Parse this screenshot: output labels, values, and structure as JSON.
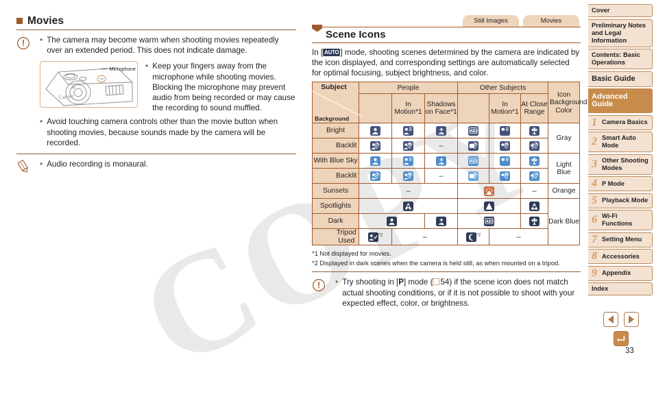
{
  "left": {
    "heading": "Movies",
    "caution_bullets": [
      "The camera may become warm when shooting movies repeatedly over an extended period. This does not indicate damage.",
      "Keep your fingers away from the microphone while shooting movies. Blocking the microphone may prevent audio from being recorded or may cause the recording to sound muffled.",
      "Avoid touching camera controls other than the movie button when shooting movies, because sounds made by the camera will be recorded."
    ],
    "figure_label": "Microphone",
    "memo_bullet": "Audio recording is monaural."
  },
  "section": {
    "tabs": [
      "Still Images",
      "Movies"
    ],
    "title": "Scene Icons",
    "intro_pre": "In [",
    "intro_chip": "AUTO",
    "intro_post": "] mode, shooting scenes determined by the camera are indicated by the icon displayed, and corresponding settings are automatically selected for optimal focusing, subject brightness, and color.",
    "footnotes": [
      "*1 Not displayed for movies.",
      "*2 Displayed in dark scenes when the camera is held still, as when mounted on a tripod."
    ],
    "caution_pre": "Try shooting in [",
    "caution_mode": "P",
    "caution_page": "54",
    "caution_post": ") if the scene icon does not match actual shooting conditions, or if it is not possible to shoot with your expected effect, color, or brightness.",
    "caution_mid": "] mode ("
  },
  "table": {
    "corner_subject": "Subject",
    "corner_background": "Background",
    "group_people": "People",
    "group_other": "Other Subjects",
    "col_icon_bg_color": "Icon Background Color",
    "sub_headers": {
      "people_in_motion": "In Motion*1",
      "people_shadows": "Shadows on Face*1",
      "other_in_motion": "In Motion*1",
      "other_close": "At Close Range"
    },
    "rows": [
      {
        "label": "Bright",
        "indent": false,
        "bgcolor": "Gray",
        "bgcolor_rowspan": 2,
        "cells": [
          {
            "kind": "icon",
            "icon": "person-icon",
            "color": "#45537a"
          },
          {
            "kind": "icon",
            "icon": "person-motion-icon",
            "color": "#45537a"
          },
          {
            "kind": "icon",
            "icon": "person-shadow-icon",
            "color": "#45537a"
          },
          {
            "kind": "icon",
            "icon": "auto-icon",
            "color": "#45537a"
          },
          {
            "kind": "icon",
            "icon": "subject-motion-icon",
            "color": "#45537a"
          },
          {
            "kind": "icon",
            "icon": "macro-flower-icon",
            "color": "#45537a"
          }
        ]
      },
      {
        "label": "Backlit",
        "indent": true,
        "bgcolor": null,
        "cells": [
          {
            "kind": "icon",
            "icon": "person-backlit-icon",
            "color": "#45537a"
          },
          {
            "kind": "icon",
            "icon": "person-motion-backlit-icon",
            "color": "#45537a"
          },
          {
            "kind": "dash",
            "text": "–"
          },
          {
            "kind": "icon",
            "icon": "auto-backlit-icon",
            "color": "#45537a"
          },
          {
            "kind": "icon",
            "icon": "subject-motion-backlit-icon",
            "color": "#45537a"
          },
          {
            "kind": "icon",
            "icon": "macro-backlit-icon",
            "color": "#45537a"
          }
        ]
      },
      {
        "label": "With Blue Sky",
        "indent": false,
        "bgcolor": "Light Blue",
        "bgcolor_rowspan": 2,
        "cells": [
          {
            "kind": "icon",
            "icon": "person-icon",
            "color": "#4e8ccb"
          },
          {
            "kind": "icon",
            "icon": "person-motion-icon",
            "color": "#4e8ccb"
          },
          {
            "kind": "icon",
            "icon": "person-shadow-icon",
            "color": "#4e8ccb"
          },
          {
            "kind": "icon",
            "icon": "auto-icon",
            "color": "#4e8ccb"
          },
          {
            "kind": "icon",
            "icon": "subject-motion-icon",
            "color": "#4e8ccb"
          },
          {
            "kind": "icon",
            "icon": "macro-flower-icon",
            "color": "#4e8ccb"
          }
        ]
      },
      {
        "label": "Backlit",
        "indent": true,
        "bgcolor": null,
        "cells": [
          {
            "kind": "icon",
            "icon": "person-backlit-icon",
            "color": "#4e8ccb"
          },
          {
            "kind": "icon",
            "icon": "person-motion-backlit-icon",
            "color": "#4e8ccb"
          },
          {
            "kind": "dash",
            "text": "–"
          },
          {
            "kind": "icon",
            "icon": "auto-backlit-icon",
            "color": "#6aa6d8"
          },
          {
            "kind": "icon",
            "icon": "subject-motion-backlit-icon",
            "color": "#4e8ccb"
          },
          {
            "kind": "icon",
            "icon": "macro-backlit-icon",
            "color": "#4e8ccb"
          }
        ]
      },
      {
        "label": "Sunsets",
        "indent": false,
        "bgcolor": "Orange",
        "bgcolor_rowspan": 1,
        "cells": [
          {
            "kind": "dash",
            "text": "–",
            "span": 3
          },
          {
            "kind": "icon",
            "icon": "sunset-icon",
            "color": "#c9683f",
            "span": 2
          },
          {
            "kind": "dash",
            "text": "–"
          }
        ]
      },
      {
        "label": "Spotlights",
        "indent": false,
        "bgcolor": "Dark Blue",
        "bgcolor_rowspan": 3,
        "cells": [
          {
            "kind": "icon",
            "icon": "spotlight-person-icon",
            "color": "#2e3a55",
            "span": 3
          },
          {
            "kind": "icon",
            "icon": "spotlight-icon",
            "color": "#2e3a55",
            "span": 2
          },
          {
            "kind": "icon",
            "icon": "spotlight-macro-icon",
            "color": "#2e3a55"
          }
        ]
      },
      {
        "label": "Dark",
        "indent": false,
        "bgcolor": null,
        "cells": [
          {
            "kind": "icon",
            "icon": "person-icon",
            "color": "#2e3a55",
            "span": 2
          },
          {
            "kind": "icon",
            "icon": "person-shadow-icon",
            "color": "#2e3a55"
          },
          {
            "kind": "icon",
            "icon": "auto-icon",
            "color": "#2e3a55",
            "span": 2
          },
          {
            "kind": "icon",
            "icon": "macro-flower-icon",
            "color": "#2e3a55"
          }
        ]
      },
      {
        "label": "Tripod Used",
        "indent": true,
        "bgcolor": null,
        "cells": [
          {
            "kind": "icon",
            "icon": "person-tripod-icon",
            "color": "#2e3a55",
            "note": "*2"
          },
          {
            "kind": "dash",
            "text": "–",
            "span": 2
          },
          {
            "kind": "icon",
            "icon": "night-moon-icon",
            "color": "#2e3a55",
            "note": "*2"
          },
          {
            "kind": "dash",
            "text": "–",
            "span": 2
          }
        ]
      }
    ]
  },
  "sidebar": {
    "items": [
      {
        "label": "Cover",
        "num": null,
        "style": "plain"
      },
      {
        "label": "Preliminary Notes and Legal Information",
        "num": null,
        "style": "plain"
      },
      {
        "label": "Contents: Basic Operations",
        "num": null,
        "style": "plain"
      },
      {
        "label": "Basic Guide",
        "num": null,
        "style": "big"
      },
      {
        "label": "Advanced Guide",
        "num": null,
        "style": "adv"
      },
      {
        "label": "Camera Basics",
        "num": "1",
        "style": "num"
      },
      {
        "label": "Smart Auto Mode",
        "num": "2",
        "style": "num"
      },
      {
        "label": "Other Shooting Modes",
        "num": "3",
        "style": "num"
      },
      {
        "label": "P Mode",
        "num": "4",
        "style": "num"
      },
      {
        "label": "Playback Mode",
        "num": "5",
        "style": "num"
      },
      {
        "label": "Wi-Fi Functions",
        "num": "6",
        "style": "num"
      },
      {
        "label": "Setting Menu",
        "num": "7",
        "style": "num"
      },
      {
        "label": "Accessories",
        "num": "8",
        "style": "num"
      },
      {
        "label": "Appendix",
        "num": "9",
        "style": "num"
      },
      {
        "label": "Index",
        "num": null,
        "style": "plain"
      }
    ]
  },
  "footer": {
    "page_number": "33",
    "nav_prev": "previous-page",
    "nav_next": "next-page",
    "nav_back": "back"
  },
  "watermark": {
    "text": "COPY"
  },
  "colors": {
    "accent_brown": "#a05a2c",
    "header_tan": "#eed4ba",
    "sidebar_tan": "#f3e2d2",
    "advanced_brown": "#c98b4b",
    "icon_navy": "#45537a",
    "icon_dark_navy": "#2e3a55",
    "icon_blue": "#4e8ccb",
    "icon_orange": "#c9683f"
  }
}
